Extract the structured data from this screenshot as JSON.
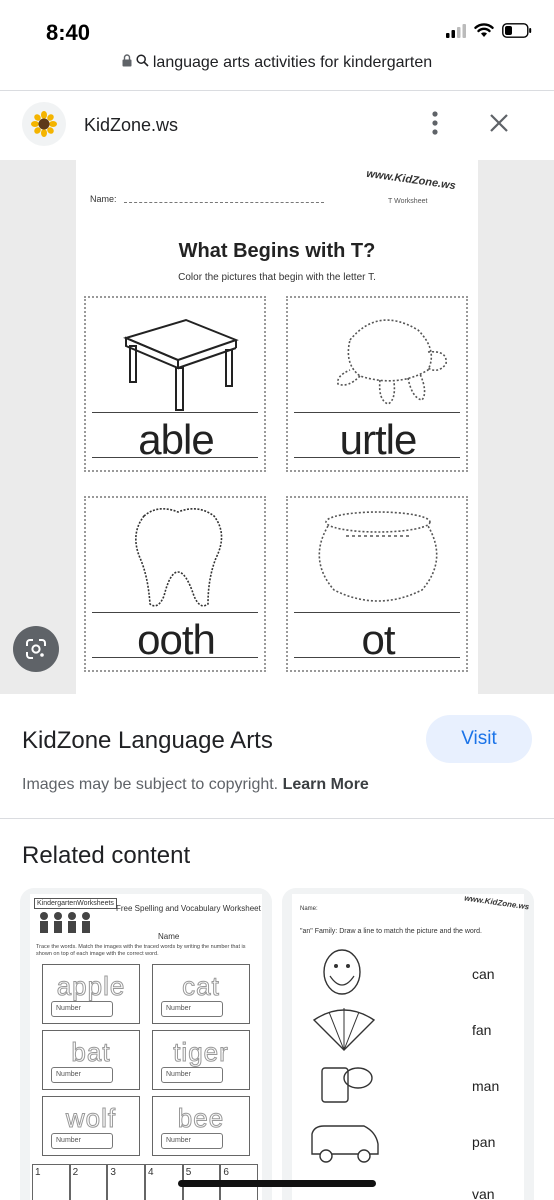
{
  "status": {
    "time": "8:40",
    "icons": [
      "cellular-icon",
      "wifi-icon",
      "battery-icon"
    ]
  },
  "url_bar": {
    "text": "language arts activities for kindergarten",
    "icons": [
      "lock-icon",
      "search-icon"
    ]
  },
  "source": {
    "name": "KidZone.ws",
    "favicon": "sunflower-icon",
    "more_icon": "more-vert-icon",
    "close_icon": "close-icon"
  },
  "worksheet": {
    "name_label": "Name:",
    "logo": "www.KidZone.ws",
    "logo_sub": "T Worksheet",
    "title": "What Begins with T?",
    "subtitle": "Color the pictures that begin with the letter T.",
    "cells": [
      {
        "word": "able",
        "picture": "table"
      },
      {
        "word": "urtle",
        "picture": "turtle"
      },
      {
        "word": "ooth",
        "picture": "tooth"
      },
      {
        "word": "ot",
        "picture": "pot"
      }
    ]
  },
  "lens": {
    "icon": "google-lens-icon"
  },
  "result": {
    "title": "KidZone Language Arts",
    "visit_label": "Visit",
    "copyright_text": "Images may be subject to copyright.",
    "learn_more": "Learn More"
  },
  "related": {
    "heading": "Related content",
    "card1": {
      "header": "KindergartenWorksheets",
      "title": "Free Spelling and Vocabulary Worksheet",
      "name_label": "Name",
      "instructions": "Trace the words. Match the images with the traced words by writing the number that is shown on top of each image with the correct word.",
      "words": [
        "apple",
        "cat",
        "bat",
        "tiger",
        "wolf",
        "bee"
      ],
      "number_label": "Number",
      "strip": [
        "1",
        "2",
        "3",
        "4",
        "5",
        "6"
      ]
    },
    "card2": {
      "name_label": "Name:",
      "logo": "www.KidZone.ws",
      "instructions": "\"an\" Family: Draw a line to match the picture and the word.",
      "words": [
        "can",
        "fan",
        "man",
        "pan",
        "van"
      ]
    }
  },
  "colors": {
    "visit_bg": "#e8f0fe",
    "visit_text": "#1a73e8",
    "image_bg": "#ebebeb",
    "secondary_text": "#5f6368"
  }
}
